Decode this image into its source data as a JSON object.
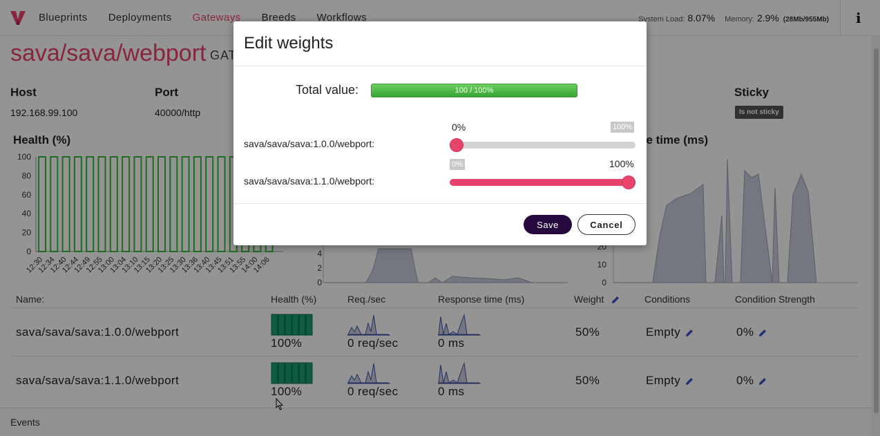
{
  "nav": {
    "items": [
      "Blueprints",
      "Deployments",
      "Gateways",
      "Breeds",
      "Workflows"
    ],
    "active": "Gateways"
  },
  "system": {
    "load_label": "System Load:",
    "load_value": "8.07%",
    "memory_label": "Memory:",
    "memory_value": "2.9%",
    "memory_detail": "(28Mb/955Mb)"
  },
  "page": {
    "title": "sava/sava/webport",
    "subtitle": "GAT",
    "host_label": "Host",
    "host_value": "192.168.99.100",
    "port_label": "Port",
    "port_value": "40000/http",
    "sticky_label": "Sticky",
    "sticky_value": "Is not sticky"
  },
  "charts": {
    "health_title": "Health (%)",
    "response_title": "se time (ms)",
    "health": {
      "type": "bar",
      "y_ticks": [
        "100",
        "80",
        "60",
        "40",
        "20",
        "0"
      ],
      "x_labels": [
        "12:30",
        "12:34",
        "12:40",
        "12:44",
        "12:49",
        "12:55",
        "13:00",
        "13:04",
        "13:10",
        "13:15",
        "13:20",
        "13:25",
        "13:30",
        "13:36",
        "13:40",
        "13:45",
        "13:51",
        "13:55",
        "14:00",
        "14:06"
      ]
    },
    "requests": {
      "y_ticks": [
        "4",
        "2",
        "0"
      ]
    },
    "response": {
      "y_ticks": [
        "20",
        "10",
        "0"
      ]
    }
  },
  "table": {
    "headers": [
      "Name:",
      "Health (%)",
      "Req./sec",
      "Response time (ms)",
      "Weight",
      "Conditions",
      "Condition Strength"
    ],
    "rows": [
      {
        "name": "sava/sava/sava:1.0.0/webport",
        "health": "100%",
        "req": "0 req/sec",
        "resp": "0 ms",
        "weight": "50%",
        "conditions": "Empty",
        "strength": "0%"
      },
      {
        "name": "sava/sava/sava:1.1.0/webport",
        "health": "100%",
        "req": "0 req/sec",
        "resp": "0 ms",
        "weight": "50%",
        "conditions": "Empty",
        "strength": "0%"
      }
    ]
  },
  "events_label": "Events",
  "modal": {
    "title": "Edit weights",
    "total_label": "Total value:",
    "total_text": "100 / 100%",
    "total_fraction": 1.0,
    "sliders": [
      {
        "label": "sava/sava/sava:1.0.0/webport:",
        "value_label": "0%",
        "max_label": "100%",
        "value": 0
      },
      {
        "label": "sava/sava/sava:1.1.0/webport:",
        "value_label": "100%",
        "min_label": "0%",
        "value": 100
      }
    ],
    "save_label": "Save",
    "cancel_label": "Cancel"
  },
  "colors": {
    "accent": "#e8436b",
    "health_bar": "#37b837",
    "save_button": "#25093e",
    "progress": "#44b23c"
  }
}
